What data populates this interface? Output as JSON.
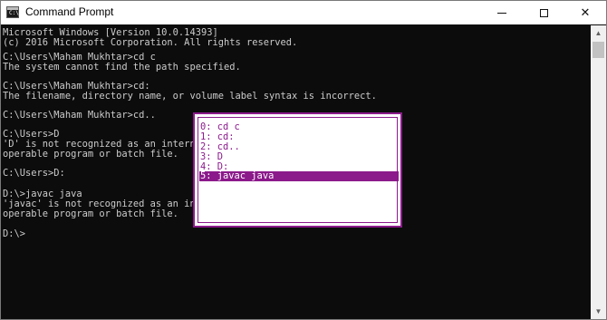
{
  "window": {
    "title": "Command Prompt",
    "app_icon_glyph": "C:\\",
    "close_glyph": "✕"
  },
  "console": {
    "lines": [
      "Microsoft Windows [Version 10.0.14393]",
      "(c) 2016 Microsoft Corporation. All rights reserved.",
      "",
      "C:\\Users\\Maham Mukhtar>cd c",
      "The system cannot find the path specified.",
      "",
      "C:\\Users\\Maham Mukhtar>cd:",
      "The filename, directory name, or volume label syntax is incorrect.",
      "",
      "C:\\Users\\Maham Mukhtar>cd..",
      "",
      "C:\\Users>D",
      "'D' is not recognized as an internal or",
      "operable program or batch file.",
      "",
      "C:\\Users>D:",
      "",
      "D:\\>javac java",
      "'javac' is not recognized as an interna",
      "operable program or batch file.",
      "",
      "D:\\>"
    ]
  },
  "history_popup": {
    "items": [
      "0: cd c",
      "1: cd:",
      "2: cd..",
      "3: D",
      "4: D:",
      "5: javac java"
    ],
    "selected_index": 5
  },
  "colors": {
    "console_bg": "#0c0c0c",
    "console_text": "#cccccc",
    "popup_accent": "#8b1a8b",
    "popup_bg": "#ffffff"
  }
}
